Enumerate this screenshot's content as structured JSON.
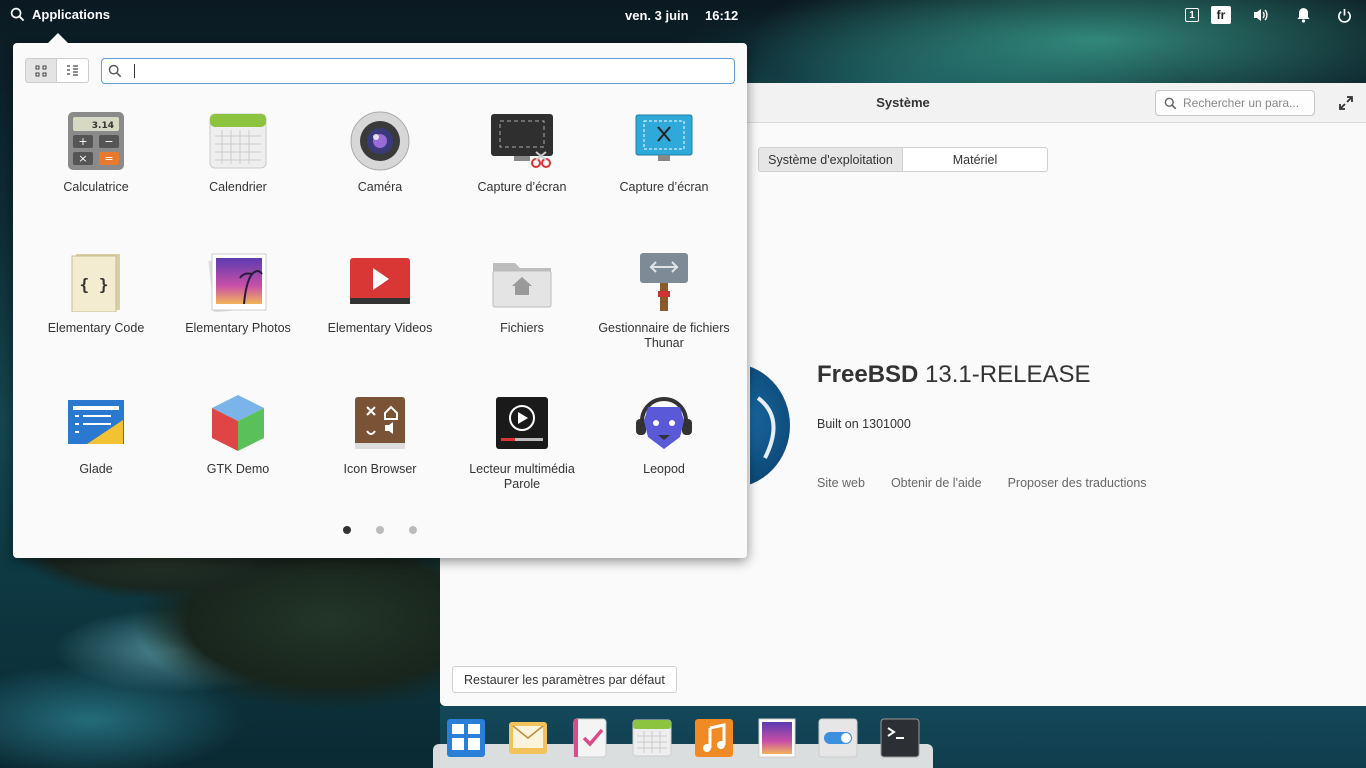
{
  "panel": {
    "applications_label": "Applications",
    "date": "ven. 3 juin",
    "time": "16:12",
    "workspace_number": "1",
    "keyboard_layout": "fr"
  },
  "app_menu": {
    "search_value": "",
    "apps": [
      {
        "label": "Calculatrice",
        "icon": "calculator-icon"
      },
      {
        "label": "Calendrier",
        "icon": "calendar-icon"
      },
      {
        "label": "Caméra",
        "icon": "camera-icon"
      },
      {
        "label": "Capture d’écran",
        "icon": "screenshot-icon"
      },
      {
        "label": "Capture d’écran",
        "icon": "screenshot-blue-icon"
      },
      {
        "label": "Elementary Code",
        "icon": "code-editor-icon"
      },
      {
        "label": "Elementary Photos",
        "icon": "photos-icon"
      },
      {
        "label": "Elementary Videos",
        "icon": "videos-icon"
      },
      {
        "label": "Fichiers",
        "icon": "files-icon"
      },
      {
        "label": "Gestionnaire de fichiers Thunar",
        "icon": "thunar-icon"
      },
      {
        "label": "Glade",
        "icon": "glade-icon"
      },
      {
        "label": "GTK Demo",
        "icon": "gtk-demo-icon"
      },
      {
        "label": "Icon Browser",
        "icon": "icon-browser-icon"
      },
      {
        "label": "Lecteur multimédia Parole",
        "icon": "parole-icon"
      },
      {
        "label": "Leopod",
        "icon": "leopod-icon"
      }
    ],
    "pages": 3,
    "current_page": 1
  },
  "settings_window": {
    "title": "Système",
    "search_placeholder": "Rechercher un para...",
    "tabs": [
      "Système d'exploitation",
      "Matériel"
    ],
    "os_name_bold": "FreeBSD",
    "os_version": "13.1-RELEASE",
    "built": "Built on 1301000",
    "links": [
      "Site web",
      "Obtenir de l'aide",
      "Proposer des traductions"
    ],
    "restore_label": "Restaurer les paramètres par défaut"
  },
  "dock": {
    "items": [
      "multitasking-icon",
      "mail-icon",
      "tasks-icon",
      "calendar-icon",
      "music-icon",
      "photos-icon",
      "settings-icon",
      "terminal-icon"
    ]
  },
  "colors": {
    "accent": "#5ea0d6",
    "popover_bg": "#fafafa"
  }
}
